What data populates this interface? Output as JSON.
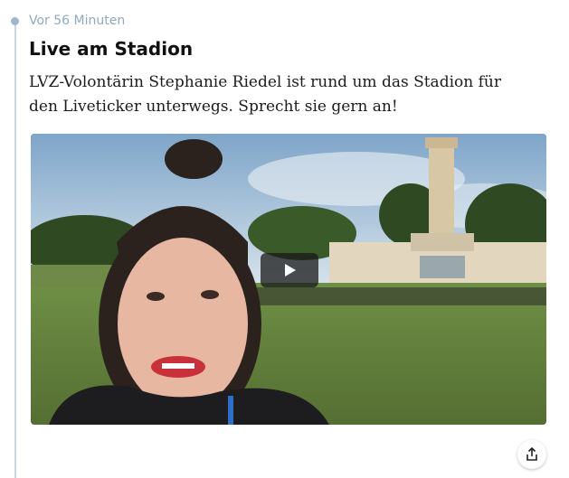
{
  "post": {
    "timestamp": "Vor 56 Minuten",
    "title": "Live am Stadion",
    "body": "LVZ-Volontärin Stephanie Riedel ist rund um das Stadion für den Liveticker unterwegs. Sprecht sie gern an!"
  },
  "video": {
    "play_icon": "play-icon",
    "state": "paused"
  },
  "actions": {
    "share_icon": "share-icon"
  },
  "colors": {
    "timeline": "#c9d6e2",
    "timestamp": "#8fa9bf",
    "title": "#111111"
  }
}
